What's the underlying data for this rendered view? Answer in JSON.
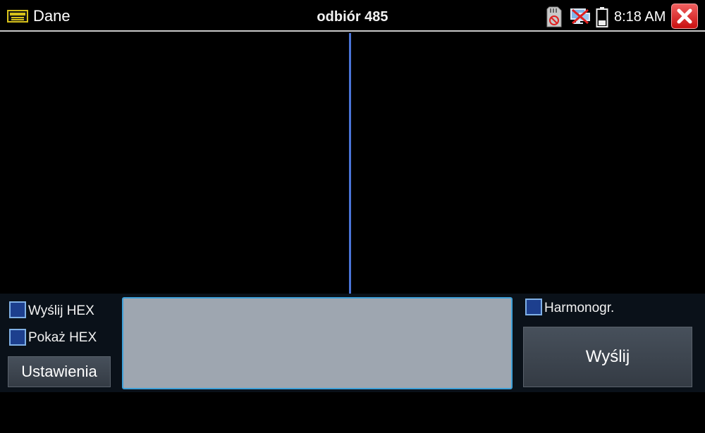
{
  "statusbar": {
    "app_icon": "data-terminal-icon",
    "app_title": "Dane",
    "mode_title": "odbiór 485",
    "clock": "8:18 AM",
    "icons": [
      "sd-card-disabled-icon",
      "network-disconnected-icon",
      "battery-icon",
      "close-icon"
    ]
  },
  "data_area": {
    "receive_text": "",
    "send_text": ""
  },
  "controls": {
    "send_hex_label": "Wyślij HEX",
    "show_hex_label": "Pokaż HEX",
    "settings_label": "Ustawienia",
    "schedule_label": "Harmonogr.",
    "send_label": "Wyślij",
    "input_value": ""
  },
  "colors": {
    "accent_line": "#4a74d8",
    "checkbox_fill": "#1d3f8e",
    "checkbox_border": "#7fb0e6",
    "close_button": "#d82020",
    "input_background": "#9ea6b0",
    "input_border": "#3ea0d8"
  }
}
